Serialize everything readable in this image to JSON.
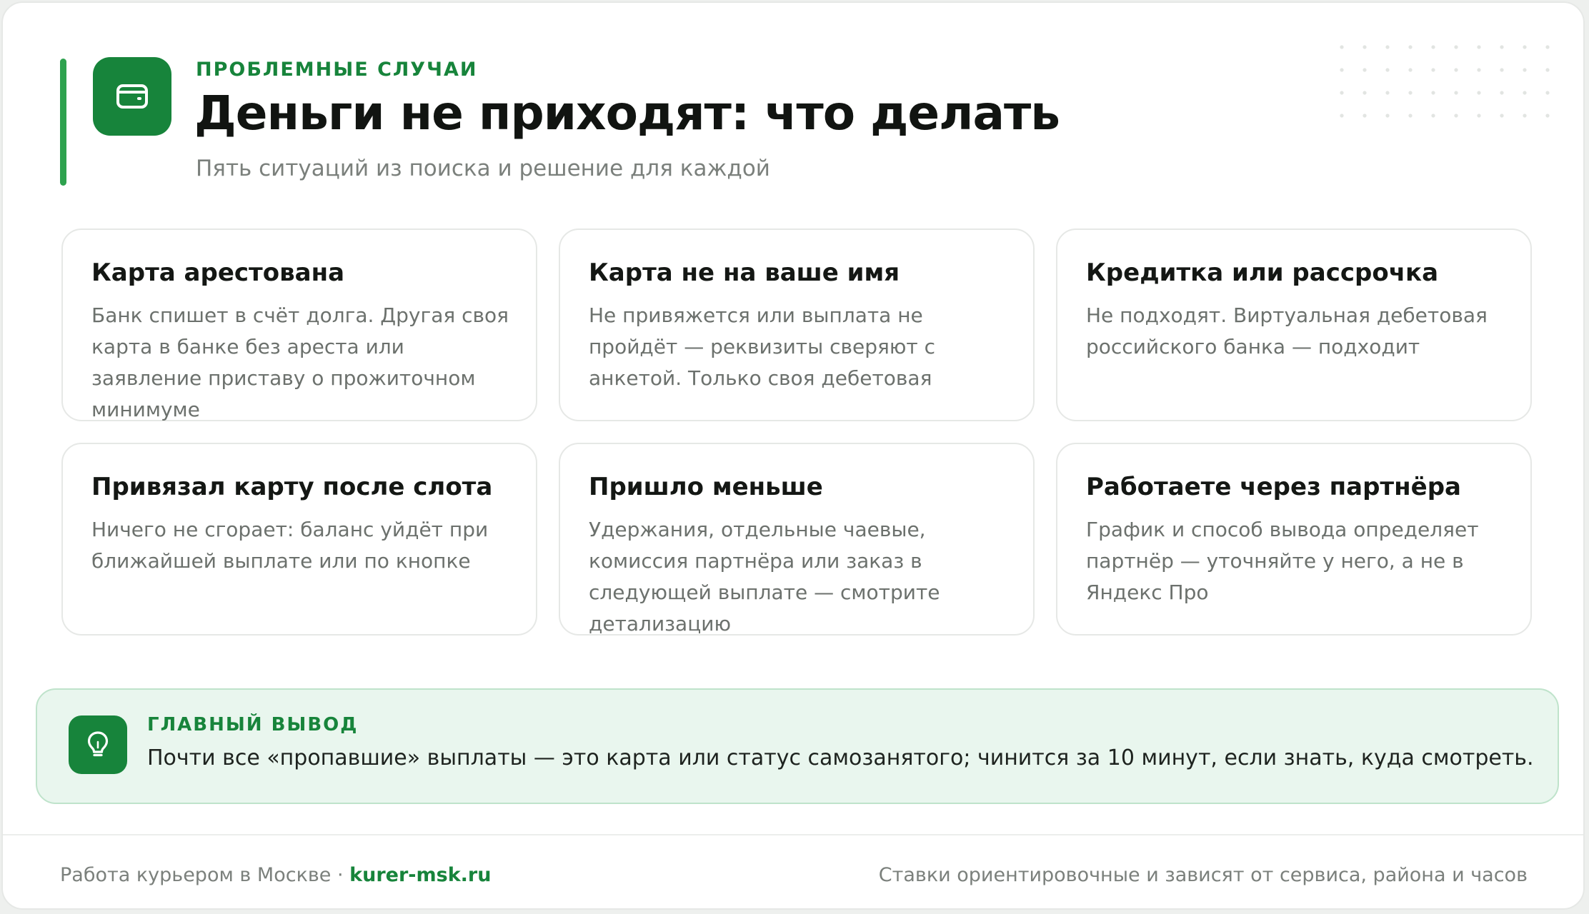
{
  "header": {
    "icon": "wallet-icon",
    "eyebrow": "ПРОБЛЕМНЫЕ СЛУЧАИ",
    "title": "Деньги не приходят: что делать",
    "subtitle": "Пять ситуаций из поиска и решение для каждой"
  },
  "cards": [
    {
      "title": "Карта арестована",
      "text": "Банк спишет в счёт долга. Другая своя карта в банке без ареста или заявление приставу о прожиточном минимуме"
    },
    {
      "title": "Карта не на ваше имя",
      "text": "Не привяжется или выплата не пройдёт — реквизиты сверяют с анкетой. Только своя дебетовая"
    },
    {
      "title": "Кредитка или рассрочка",
      "text": "Не подходят. Виртуальная дебетовая российского банка — подходит"
    },
    {
      "title": "Привязал карту после слота",
      "text": "Ничего не сгорает: баланс уйдёт при ближайшей выплате или по кнопке"
    },
    {
      "title": "Пришло меньше",
      "text": "Удержания, отдельные чаевые, комиссия партнёра или заказ в следующей выплате — смотрите детализацию"
    },
    {
      "title": "Работаете через партнёра",
      "text": "График и способ вывода определяет партнёр — уточняйте у него, а не в Яндекс Про"
    }
  ],
  "callout": {
    "icon": "lightbulb-icon",
    "label": "ГЛАВНЫЙ ВЫВОД",
    "text": "Почти все «пропавшие» выплаты — это карта или статус самозанятого; чинится за 10 минут, если знать, куда смотреть."
  },
  "footer": {
    "left_text": "Работа курьером в Москве · ",
    "site": "kurer-msk.ru",
    "right_text": "Ставки ориентировочные и зависят от сервиса, района и часов"
  },
  "colors": {
    "accent": "#17843b",
    "accent_light": "#2ea24e",
    "callout_bg": "#e9f6ee"
  }
}
